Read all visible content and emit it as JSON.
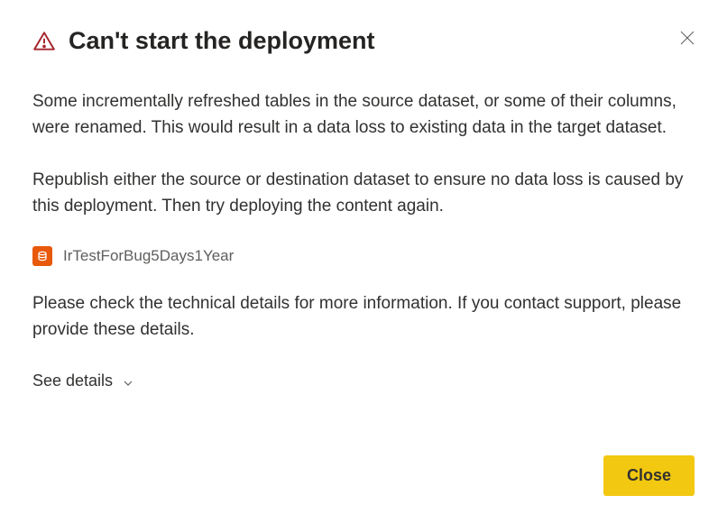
{
  "dialog": {
    "title": "Can't start the deployment",
    "paragraph1": "Some incrementally refreshed tables in the source dataset, or some of their columns, were renamed. This would result in a data loss to existing data in the target dataset.",
    "paragraph2": "Republish either the source or destination dataset to ensure no data loss is caused by this deployment. Then try deploying the content again.",
    "dataset_name": "IrTestForBug5Days1Year",
    "paragraph3": "Please check the technical details for more information. If you contact support, please provide these details.",
    "see_details_label": "See details",
    "close_button_label": "Close"
  },
  "colors": {
    "warning_red": "#a4262c",
    "dataset_orange": "#e8590c",
    "primary_yellow": "#f2c811"
  }
}
